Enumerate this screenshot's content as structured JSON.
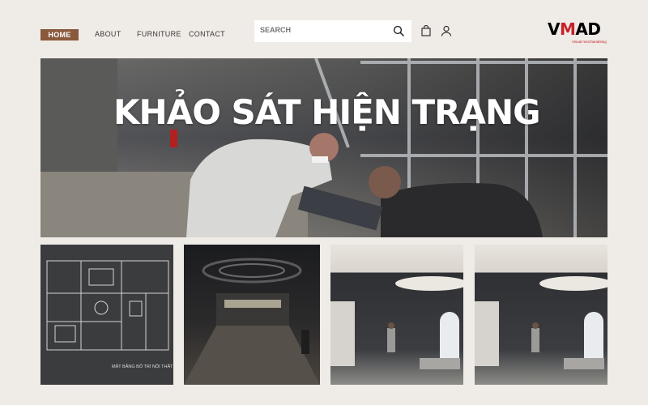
{
  "nav": {
    "items": [
      {
        "label": "HOME"
      },
      {
        "label": "ABOUT"
      },
      {
        "label": "FURNITURE"
      },
      {
        "label": "CONTACT"
      }
    ],
    "search_placeholder": "SEARCH",
    "active_color": "#8a5a3d"
  },
  "icons": {
    "search": "search-icon",
    "cart": "shopping-bag-icon",
    "account": "user-icon"
  },
  "logo": {
    "text_dark_1": "V",
    "text_red": "M",
    "text_dark_2": "AD",
    "tagline": "Visual merchandising",
    "brand_red": "#c8202a"
  },
  "hero": {
    "title": "KHẢO SÁT HIỆN TRẠNG"
  },
  "gallery": {
    "plan_caption": "MẶT BẰNG BỐ TRÍ NỘI THẤT"
  }
}
